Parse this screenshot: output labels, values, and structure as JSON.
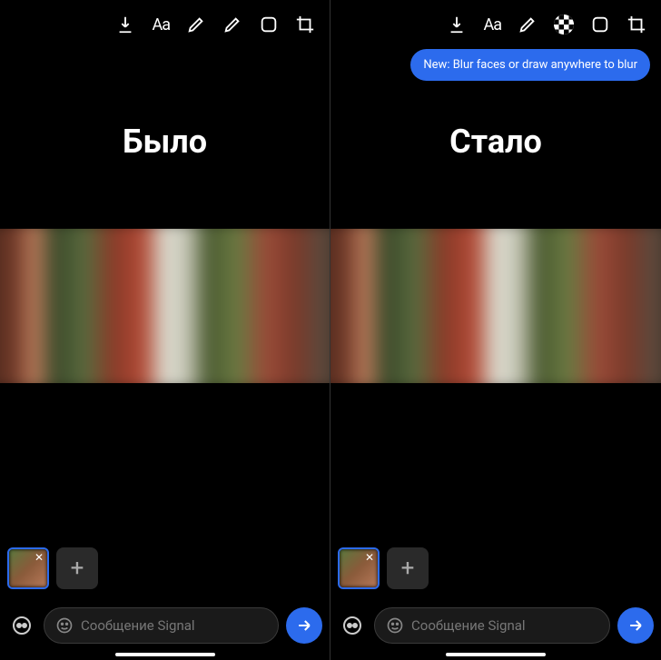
{
  "left": {
    "heading": "Было",
    "toolbar": {
      "text_tool": "Aa"
    },
    "thumb_close": "✕",
    "add_label": "+",
    "message_placeholder": "Сообщение Signal"
  },
  "right": {
    "heading": "Стало",
    "toolbar": {
      "text_tool": "Aa"
    },
    "tooltip": "New: Blur faces or draw anywhere to blur",
    "thumb_close": "✕",
    "add_label": "+",
    "message_placeholder": "Сообщение Signal"
  },
  "colors": {
    "accent": "#2c6bed",
    "bg": "#000000"
  }
}
